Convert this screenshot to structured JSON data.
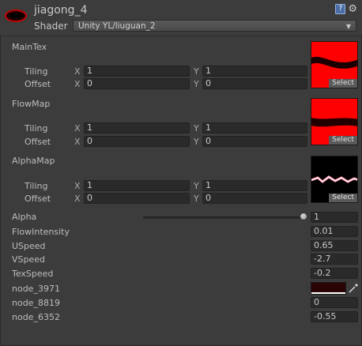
{
  "header": {
    "title": "jiagong_4",
    "shader_label": "Shader",
    "shader_value": "Unity YL/liuguan_2",
    "help_icon": "?",
    "gear_icon": "⚙",
    "dropdown_arrow": "▼"
  },
  "textures": [
    {
      "name": "MainTex",
      "tiling_label": "Tiling",
      "offset_label": "Offset",
      "tiling_x": "1",
      "tiling_y": "1",
      "offset_x": "0",
      "offset_y": "0",
      "select_label": "Select",
      "preview": "red-wave"
    },
    {
      "name": "FlowMap",
      "tiling_label": "Tiling",
      "offset_label": "Offset",
      "tiling_x": "1",
      "tiling_y": "1",
      "offset_x": "0",
      "offset_y": "0",
      "select_label": "Select",
      "preview": "red-band"
    },
    {
      "name": "AlphaMap",
      "tiling_label": "Tiling",
      "offset_label": "Offset",
      "tiling_x": "1",
      "tiling_y": "1",
      "offset_x": "0",
      "offset_y": "0",
      "select_label": "Select",
      "preview": "pink-lightning"
    }
  ],
  "axes": {
    "x": "X",
    "y": "Y"
  },
  "properties": [
    {
      "label": "Alpha",
      "value": "1",
      "slider_level": 1.0
    },
    {
      "label": "FlowIntensity",
      "value": "0.01"
    },
    {
      "label": "USpeed",
      "value": "0.65"
    },
    {
      "label": "VSpeed",
      "value": "-2.7"
    },
    {
      "label": "TexSpeed",
      "value": "-0.2"
    },
    {
      "label": "node_3971",
      "value": "",
      "color": "#2a0404"
    },
    {
      "label": "node_8819",
      "value": "0"
    },
    {
      "label": "node_6352",
      "value": "-0.55"
    }
  ],
  "colors": {
    "background": "#3c3c3c",
    "field": "#2a2a2a",
    "tex_red": "#ff0000",
    "node_3971": "#2a0404"
  }
}
